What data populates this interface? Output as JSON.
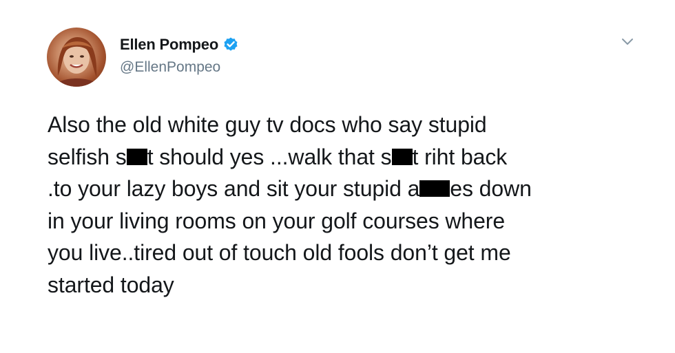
{
  "tweet": {
    "author": {
      "display_name": "Ellen Pompeo",
      "handle": "@EllenPompeo",
      "verified": true,
      "avatar_icon": "profile-photo",
      "verified_icon": "verified-badge-icon",
      "verified_color": "#1da1f2"
    },
    "menu_icon": "chevron-down-icon",
    "lines": [
      {
        "segments": [
          "Also the old white guy tv docs who say stupid"
        ]
      },
      {
        "segments": [
          "selfish s",
          "[redacted]",
          "t should yes ...walk that s",
          "[redacted]",
          "t riht back"
        ]
      },
      {
        "segments": [
          ".to your lazy boys and sit your stupid a",
          "[redacted]",
          "es down"
        ]
      },
      {
        "segments": [
          "in your living rooms on your golf courses where"
        ]
      },
      {
        "segments": [
          "you live..tired out of touch old fools don’t get me"
        ]
      },
      {
        "segments": [
          "started today"
        ]
      }
    ]
  },
  "colors": {
    "text": "#14171a",
    "secondary_text": "#657786",
    "background": "#ffffff",
    "redaction": "#000000"
  }
}
